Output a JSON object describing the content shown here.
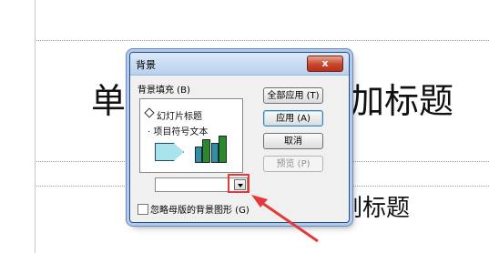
{
  "slide": {
    "title_left": "单",
    "title_right": "加标题",
    "subtitle_right": "副标题"
  },
  "dialog": {
    "title": "背景",
    "close_glyph": "x",
    "fill_group_label": "背景填充 (B)",
    "preview": {
      "title": "幻灯片标题",
      "bullet": "· 项目符号文本"
    },
    "buttons": {
      "apply_all": "全部应用 (T)",
      "apply": "应用 (A)",
      "cancel": "取消",
      "preview": "预览 (P)"
    },
    "omit_master_label": "忽略母版的背景图形 (G)"
  },
  "colors": {
    "highlight": "#e23a3a",
    "arrow": "#e23a3a",
    "preview_shape_fill": "#a9e3ec",
    "chart_bar_green": "#2a8a2a",
    "chart_bar_teal": "#2f8fa6"
  },
  "icons": {
    "close": "close-icon",
    "dropdown": "chevron-down-icon",
    "annotation": "red-arrow-annotation"
  }
}
